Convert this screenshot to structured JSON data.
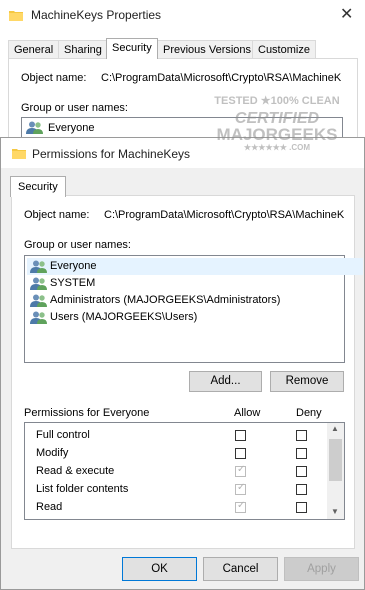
{
  "background_window": {
    "title": "MachineKeys Properties",
    "tabs": [
      "General",
      "Sharing",
      "Security",
      "Previous Versions",
      "Customize"
    ],
    "active_tab": "Security",
    "object_name_label": "Object name:",
    "object_name_value": "C:\\ProgramData\\Microsoft\\Crypto\\RSA\\MachineK",
    "group_label": "Group or user names:",
    "first_user": "Everyone"
  },
  "watermark": {
    "line1": "TESTED ★100% CLEAN",
    "line2": "CERTIFIED",
    "line3": "MAJORGEEKS",
    "line4": "★★★★★★ .COM"
  },
  "dialog": {
    "title": "Permissions for MachineKeys",
    "tab": "Security",
    "object_name_label": "Object name:",
    "object_name_value": "C:\\ProgramData\\Microsoft\\Crypto\\RSA\\MachineK",
    "group_label": "Group or user names:",
    "users": [
      {
        "name": "Everyone",
        "selected": true
      },
      {
        "name": "SYSTEM",
        "selected": false
      },
      {
        "name": "Administrators (MAJORGEEKS\\Administrators)",
        "selected": false
      },
      {
        "name": "Users (MAJORGEEKS\\Users)",
        "selected": false
      }
    ],
    "add_button": "Add...",
    "remove_button": "Remove",
    "perm_header": "Permissions for Everyone",
    "allow_header": "Allow",
    "deny_header": "Deny",
    "permissions": [
      {
        "name": "Full control",
        "allow": false,
        "allow_inherited": false,
        "deny": false
      },
      {
        "name": "Modify",
        "allow": false,
        "allow_inherited": false,
        "deny": false
      },
      {
        "name": "Read & execute",
        "allow": true,
        "allow_inherited": true,
        "deny": false
      },
      {
        "name": "List folder contents",
        "allow": true,
        "allow_inherited": true,
        "deny": false
      },
      {
        "name": "Read",
        "allow": true,
        "allow_inherited": true,
        "deny": false
      }
    ],
    "ok_button": "OK",
    "cancel_button": "Cancel",
    "apply_button": "Apply"
  },
  "colors": {
    "selection": "#e5f3ff",
    "focus_border": "#0078d7",
    "dialog_bg": "#f0f0f0"
  }
}
